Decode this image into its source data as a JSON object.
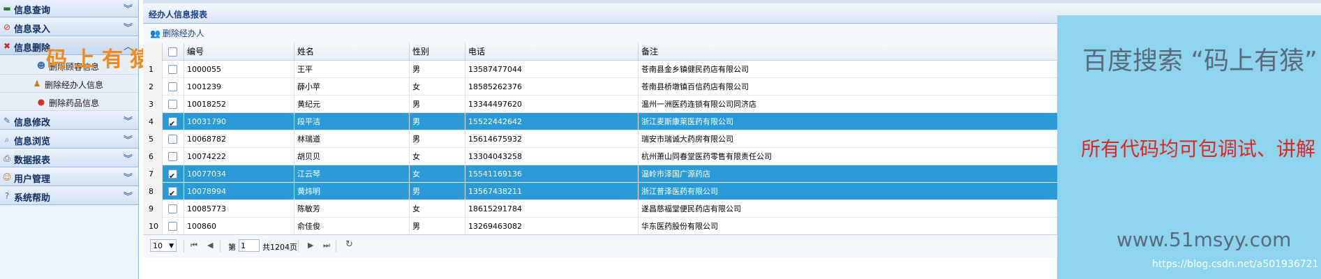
{
  "sidebar": {
    "sections": [
      {
        "label": "信息查询",
        "icon": "screen-icon"
      },
      {
        "label": "信息录入",
        "icon": "edit-circle-icon"
      },
      {
        "label": "信息删除",
        "icon": "delete-x-icon"
      },
      {
        "label": "信息修改",
        "icon": "pencil-icon"
      },
      {
        "label": "信息浏览",
        "icon": "magnifier-icon"
      },
      {
        "label": "数据报表",
        "icon": "printer-icon"
      },
      {
        "label": "用户管理",
        "icon": "user-icon"
      },
      {
        "label": "系统帮助",
        "icon": "help-icon"
      }
    ],
    "delete_items": [
      {
        "label": "删除顾客信息",
        "icon": "customer-icon"
      },
      {
        "label": "删除经办人信息",
        "icon": "agent-icon"
      },
      {
        "label": "删除药品信息",
        "icon": "pill-icon"
      }
    ],
    "watermark": "码上有猿"
  },
  "main": {
    "title": "经办人信息报表",
    "toolbar": {
      "delete_label": "删除经办人"
    }
  },
  "grid": {
    "columns": [
      "编号",
      "姓名",
      "性别",
      "电话",
      "备注"
    ],
    "rows": [
      {
        "num": "1",
        "checked": false,
        "selected": false,
        "id": "1000055",
        "name": "王平",
        "sex": "男",
        "phone": "13587477044",
        "note": "苍南县金乡镇健民药店有限公司"
      },
      {
        "num": "2",
        "checked": false,
        "selected": false,
        "id": "1001239",
        "name": "薛小苹",
        "sex": "女",
        "phone": "18585262376",
        "note": "苍南县桥墩镇百信药店有限公司"
      },
      {
        "num": "3",
        "checked": false,
        "selected": false,
        "id": "10018252",
        "name": "黄纪元",
        "sex": "男",
        "phone": "13344497620",
        "note": "温州一洲医药连锁有限公司同济店"
      },
      {
        "num": "4",
        "checked": true,
        "selected": true,
        "id": "10031790",
        "name": "段平洁",
        "sex": "男",
        "phone": "15522442642",
        "note": "浙江麦斯康莱医药有限公司"
      },
      {
        "num": "5",
        "checked": false,
        "selected": false,
        "id": "10068782",
        "name": "林瑞道",
        "sex": "男",
        "phone": "15614675932",
        "note": "瑞安市瑞诚大药房有限公司"
      },
      {
        "num": "6",
        "checked": false,
        "selected": false,
        "id": "10074222",
        "name": "胡贝贝",
        "sex": "女",
        "phone": "13304043258",
        "note": "杭州萧山同春堂医药零售有限责任公司"
      },
      {
        "num": "7",
        "checked": true,
        "selected": true,
        "id": "10077034",
        "name": "江云琴",
        "sex": "女",
        "phone": "15541169136",
        "note": "温岭市泽国广源药店"
      },
      {
        "num": "8",
        "checked": true,
        "selected": true,
        "id": "10078994",
        "name": "黄炜明",
        "sex": "男",
        "phone": "13567438211",
        "note": "浙江普泽医药有限公司"
      },
      {
        "num": "9",
        "checked": false,
        "selected": false,
        "id": "10085773",
        "name": "陈敏芳",
        "sex": "女",
        "phone": "18615291784",
        "note": "遂昌慈福堂便民药店有限公司"
      },
      {
        "num": "10",
        "checked": false,
        "selected": false,
        "id": "100860",
        "name": "俞佳俊",
        "sex": "男",
        "phone": "13269463082",
        "note": "华东医药股份有限公司"
      }
    ]
  },
  "pager": {
    "page_size": "10",
    "page_prefix": "第",
    "page_value": "1",
    "page_total": "共1204页"
  },
  "overlay": {
    "line1": "百度搜索 “码上有猿”",
    "line2": "所有代码均可包调试、讲解",
    "line3": "www.51msyy.com",
    "line4": "https://blog.csdn.net/a501936721"
  },
  "colors": {
    "selected_row": "#2b9bd8",
    "overlay_bg": "#8dd4ee",
    "overlay_red": "#e8231e",
    "watermark_orange": "#f28a1a"
  }
}
